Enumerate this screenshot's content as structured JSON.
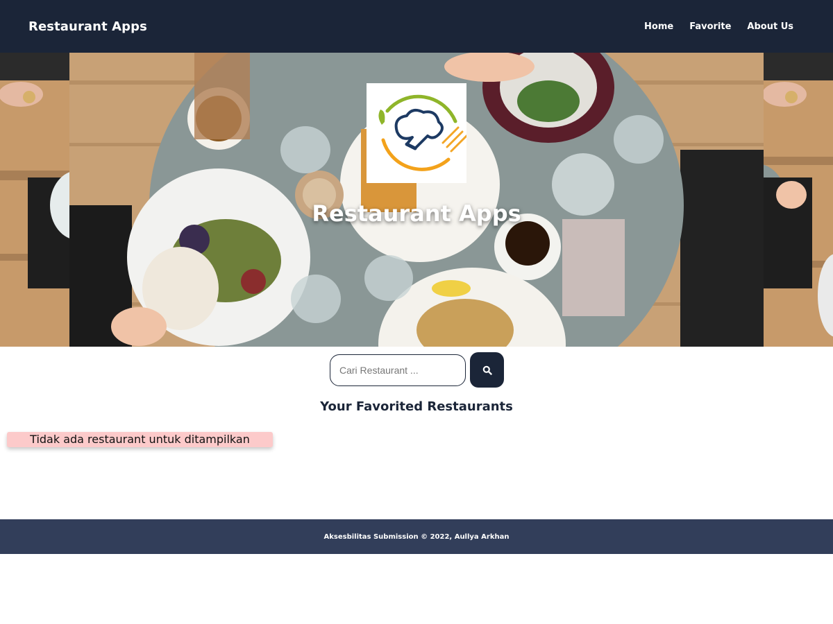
{
  "navbar": {
    "brand": "Restaurant Apps",
    "links": [
      {
        "label": "Home"
      },
      {
        "label": "Favorite"
      },
      {
        "label": "About Us"
      }
    ]
  },
  "hero": {
    "title": "Restaurant Apps",
    "logo_icon": "chef-hat-plate-icon",
    "background": "food-table-photo"
  },
  "search": {
    "placeholder": "Cari Restaurant ...",
    "value": "",
    "button_icon": "search-icon"
  },
  "main": {
    "section_title": "Your Favorited Restaurants",
    "empty_message": "Tidak ada restaurant untuk ditampilkan"
  },
  "footer": {
    "text": "Aksesbilitas Submission © 2022, Aullya Arkhan"
  },
  "colors": {
    "navbar_bg": "#1b2538",
    "footer_bg": "#323e5a",
    "empty_bg": "#fccaca",
    "logo_green": "#8fb52a",
    "logo_orange": "#f3a21b",
    "logo_navy": "#1d3a63"
  }
}
